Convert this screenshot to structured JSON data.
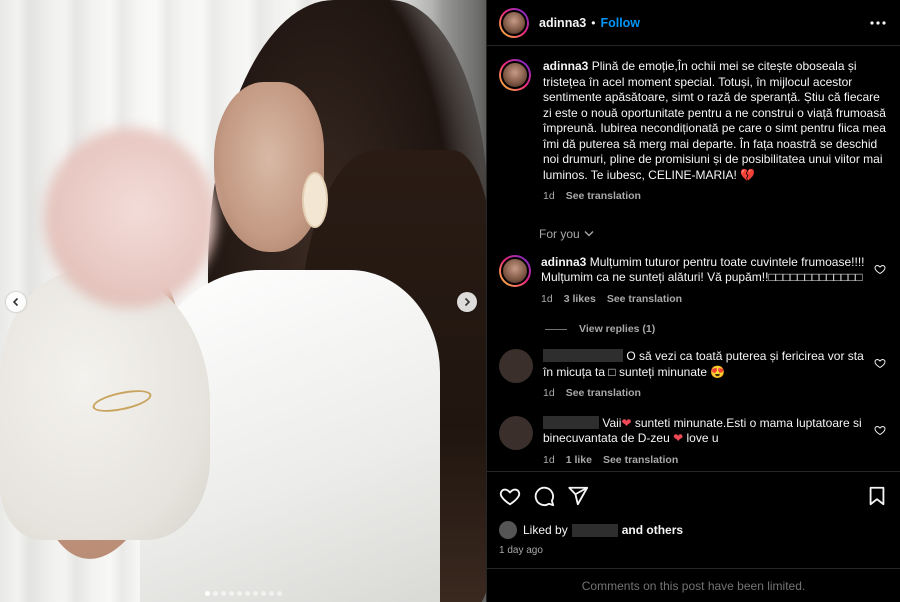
{
  "post": {
    "username": "adinna3",
    "follow_label": "Follow",
    "separator": "•",
    "caption_username": "adinna3",
    "caption_text": "Plină de emoție,În ochii mei se citește oboseala și tristețea în acel moment special. Totuși, în mijlocul acestor sentimente apăsătoare, simt o rază de speranță. Știu că fiecare zi este o nouă oportunitate pentru a ne construi o viață frumoasă împreună. Iubirea necondiționată pe care o simt pentru fiica mea îmi dă puterea să merg mai departe. În fața noastră se deschid noi drumuri, pline de promisiuni și de posibilitatea unui viitor mai luminos. Te iubesc, CELINE-MARIA! 💔",
    "caption_age": "1d",
    "see_translation": "See translation",
    "for_you_label": "For you",
    "comments": [
      {
        "username": "adinna3",
        "text": "Mulțumim tuturor pentru toate cuvintele frumoase!!!! Mulțumim ca ne sunteți alături! Vă pupăm!!□□□□□□□□□□□□□",
        "age": "1d",
        "likes": "3 likes",
        "translation": "See translation",
        "view_replies": "View replies (1)"
      },
      {
        "username": "",
        "text": "O să vezi ca toată puterea și fericirea vor sta în micuța ta □ sunteți minunate 😍",
        "age": "1d",
        "translation": "See translation"
      },
      {
        "username": "",
        "text_a": "Vaii",
        "text_b": "sunteti minunate.Esti o mama luptatoare si binecuvantata de D-zeu",
        "text_c": "love u",
        "age": "1d",
        "likes": "1 like",
        "translation": "See translation"
      }
    ],
    "liked_by_prefix": "Liked by",
    "liked_by_suffix": "and others",
    "post_age": "1 day ago",
    "comments_limited": "Comments on this post have been limited."
  },
  "carousel": {
    "slide_count": 10,
    "active_index": 0
  },
  "colors": {
    "accent": "#0095f6",
    "background": "#000000",
    "muted": "#a8a8a8",
    "heart_red": "#ed4956"
  },
  "icons": [
    "more-icon",
    "heart-icon",
    "comment-icon",
    "share-icon",
    "save-icon",
    "chevron-left-icon",
    "chevron-right-icon",
    "chevron-down-icon"
  ]
}
